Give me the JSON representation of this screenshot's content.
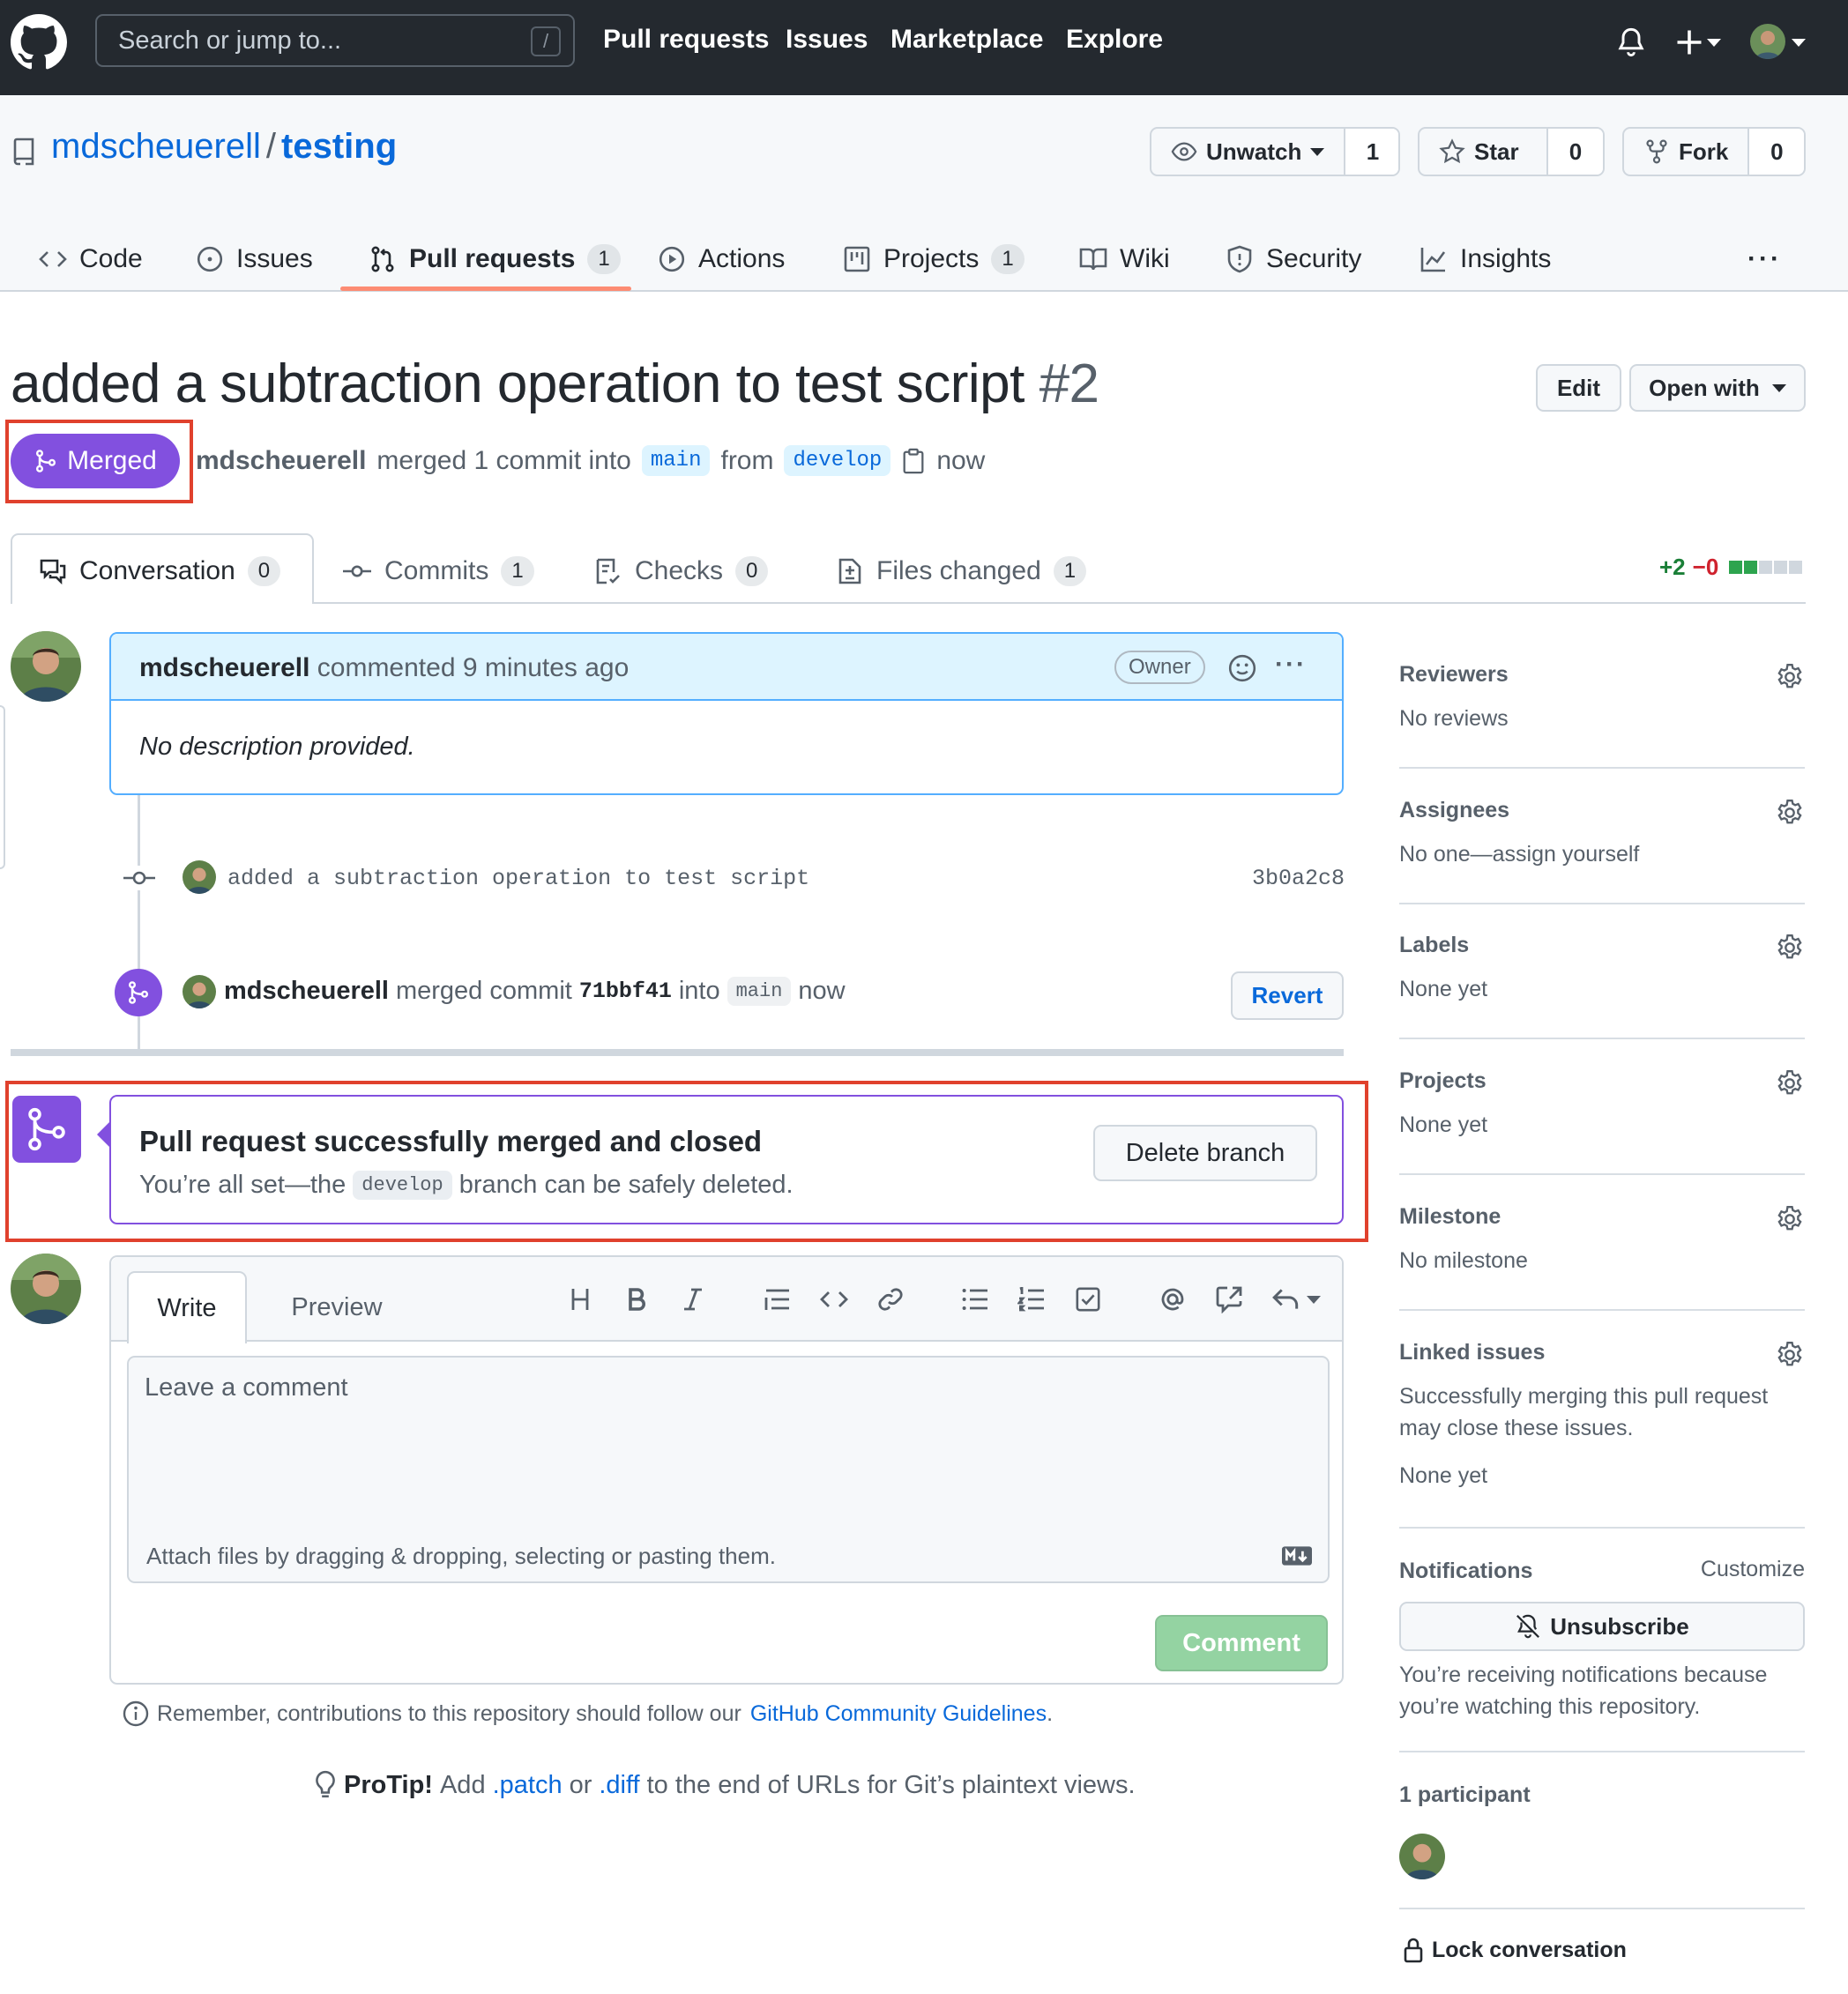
{
  "header": {
    "search_placeholder": "Search or jump to...",
    "search_key": "/",
    "nav": [
      "Pull requests",
      "Issues",
      "Marketplace",
      "Explore"
    ]
  },
  "repo": {
    "owner": "mdscheuerell",
    "name": "testing",
    "watch_label": "Unwatch",
    "watch_count": "1",
    "star_label": "Star",
    "star_count": "0",
    "fork_label": "Fork",
    "fork_count": "0",
    "tabs": [
      {
        "label": "Code",
        "icon": "code-icon"
      },
      {
        "label": "Issues",
        "icon": "issue-icon"
      },
      {
        "label": "Pull requests",
        "icon": "pull-request-icon",
        "count": "1",
        "active": true
      },
      {
        "label": "Actions",
        "icon": "play-icon"
      },
      {
        "label": "Projects",
        "icon": "project-icon",
        "count": "1"
      },
      {
        "label": "Wiki",
        "icon": "book-icon"
      },
      {
        "label": "Security",
        "icon": "shield-icon"
      },
      {
        "label": "Insights",
        "icon": "graph-icon"
      }
    ],
    "more": "···"
  },
  "pr": {
    "title": "added a subtraction operation to test script",
    "number": "#2",
    "edit_label": "Edit",
    "open_with_label": "Open with",
    "state": "Merged",
    "author": "mdscheuerell",
    "merge_text": "merged 1 commit into",
    "base_branch": "main",
    "from_text": "from",
    "head_branch": "develop",
    "time": "now",
    "tabs": [
      {
        "label": "Conversation",
        "count": "0"
      },
      {
        "label": "Commits",
        "count": "1"
      },
      {
        "label": "Checks",
        "count": "0"
      },
      {
        "label": "Files changed",
        "count": "1"
      }
    ],
    "diff_add": "+2",
    "diff_del": "−0"
  },
  "comment": {
    "author": "mdscheuerell",
    "action": "commented 9 minutes ago",
    "role": "Owner",
    "more": "···",
    "body": "No description provided."
  },
  "commit": {
    "message": "added a subtraction operation to test script",
    "sha": "3b0a2c8"
  },
  "merge_event": {
    "author": "mdscheuerell",
    "text": "merged commit",
    "sha": "71bbf41",
    "into": "into",
    "branch": "main",
    "time": "now",
    "revert_label": "Revert"
  },
  "merged_panel": {
    "title": "Pull request successfully merged and closed",
    "sub_before": "You’re all set—the",
    "branch": "develop",
    "sub_after": "branch can be safely deleted.",
    "delete_label": "Delete branch"
  },
  "composer": {
    "write_tab": "Write",
    "preview_tab": "Preview",
    "placeholder": "Leave a comment",
    "attach_text": "Attach files by dragging & dropping, selecting or pasting them.",
    "comment_label": "Comment",
    "toolbar_icons": [
      "heading-icon",
      "bold-icon",
      "italic-icon",
      "quote-icon",
      "code-icon",
      "link-icon",
      "unordered-list-icon",
      "ordered-list-icon",
      "task-list-icon",
      "mention-icon",
      "cross-reference-icon",
      "reply-icon"
    ]
  },
  "guidelines": {
    "before": "Remember, contributions to this repository should follow our",
    "link": "GitHub Community Guidelines",
    "after": "."
  },
  "protip": {
    "label": "ProTip!",
    "t1": "Add",
    "patch": ".patch",
    "t2": "or",
    "diff": ".diff",
    "t3": "to the end of URLs for Git’s plaintext views."
  },
  "sidebar": {
    "reviewers_title": "Reviewers",
    "reviewers_value": "No reviews",
    "assignees_title": "Assignees",
    "assignees_value": "No one—assign yourself",
    "labels_title": "Labels",
    "labels_value": "None yet",
    "projects_title": "Projects",
    "projects_value": "None yet",
    "milestone_title": "Milestone",
    "milestone_value": "No milestone",
    "linked_title": "Linked issues",
    "linked_desc": "Successfully merging this pull request may close these issues.",
    "linked_value": "None yet",
    "notifications_title": "Notifications",
    "customize": "Customize",
    "unsubscribe": "Unsubscribe",
    "notifications_desc": "You’re receiving notifications because you’re watching this repository.",
    "participants": "1 participant",
    "lock": "Lock conversation"
  },
  "colors": {
    "merged_purple": "#8250df",
    "header_bg": "#24292f",
    "link_blue": "#0969da",
    "highlight_red": "#e0412d"
  }
}
